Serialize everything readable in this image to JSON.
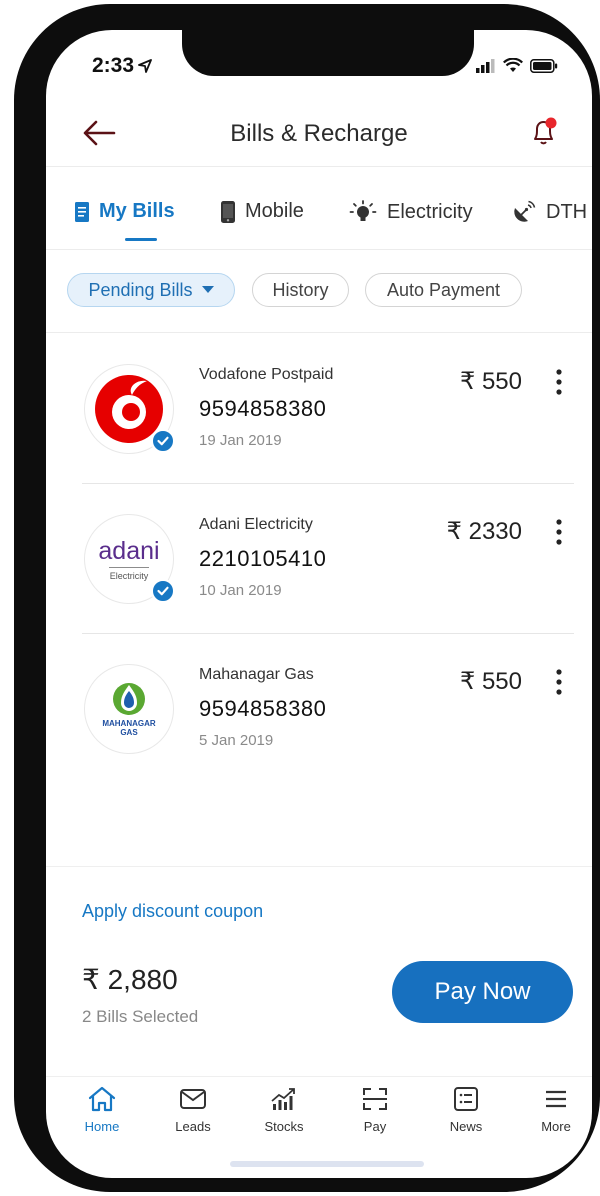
{
  "status_bar": {
    "time": "2:33"
  },
  "header": {
    "title": "Bills & Recharge"
  },
  "tabs": [
    {
      "label": "My Bills",
      "icon": "bill-icon",
      "active": true
    },
    {
      "label": "Mobile",
      "icon": "mobile-icon",
      "active": false
    },
    {
      "label": "Electricity",
      "icon": "bulb-icon",
      "active": false
    },
    {
      "label": "DTH",
      "icon": "satellite-icon",
      "active": false
    }
  ],
  "filters": [
    {
      "label": "Pending Bills",
      "active": true
    },
    {
      "label": "History",
      "active": false
    },
    {
      "label": "Auto Payment",
      "active": false
    }
  ],
  "bills": [
    {
      "provider": "Vodafone Postpaid",
      "number": "9594858380",
      "date": "19 Jan 2019",
      "amount": "₹ 550",
      "selected": true,
      "logo": "vodafone-logo"
    },
    {
      "provider": "Adani Electricity",
      "number": "2210105410",
      "date": "10 Jan 2019",
      "amount": "₹ 2330",
      "selected": true,
      "logo": "adani-logo",
      "logo_text": "adani",
      "logo_subtext": "Electricity"
    },
    {
      "provider": "Mahanagar Gas",
      "number": "9594858380",
      "date": "5 Jan 2019",
      "amount": "₹ 550",
      "selected": false,
      "logo": "mahanagar-gas-logo",
      "logo_text": "MAHANAGAR",
      "logo_subtext": "GAS"
    }
  ],
  "footer": {
    "coupon_label": "Apply discount coupon",
    "total": "₹ 2,880",
    "selected_label": "2 Bills Selected",
    "pay_label": "Pay Now"
  },
  "bottom_nav": [
    {
      "label": "Home",
      "icon": "home-icon",
      "active": true
    },
    {
      "label": "Leads",
      "icon": "mail-icon",
      "active": false
    },
    {
      "label": "Stocks",
      "icon": "stocks-icon",
      "active": false
    },
    {
      "label": "Pay",
      "icon": "scan-icon",
      "active": false
    },
    {
      "label": "News",
      "icon": "news-icon",
      "active": false
    },
    {
      "label": "More",
      "icon": "menu-icon",
      "active": false
    }
  ],
  "colors": {
    "accent": "#1778c4",
    "pay_button": "#1770bf",
    "notification_dot": "#e8262c"
  }
}
